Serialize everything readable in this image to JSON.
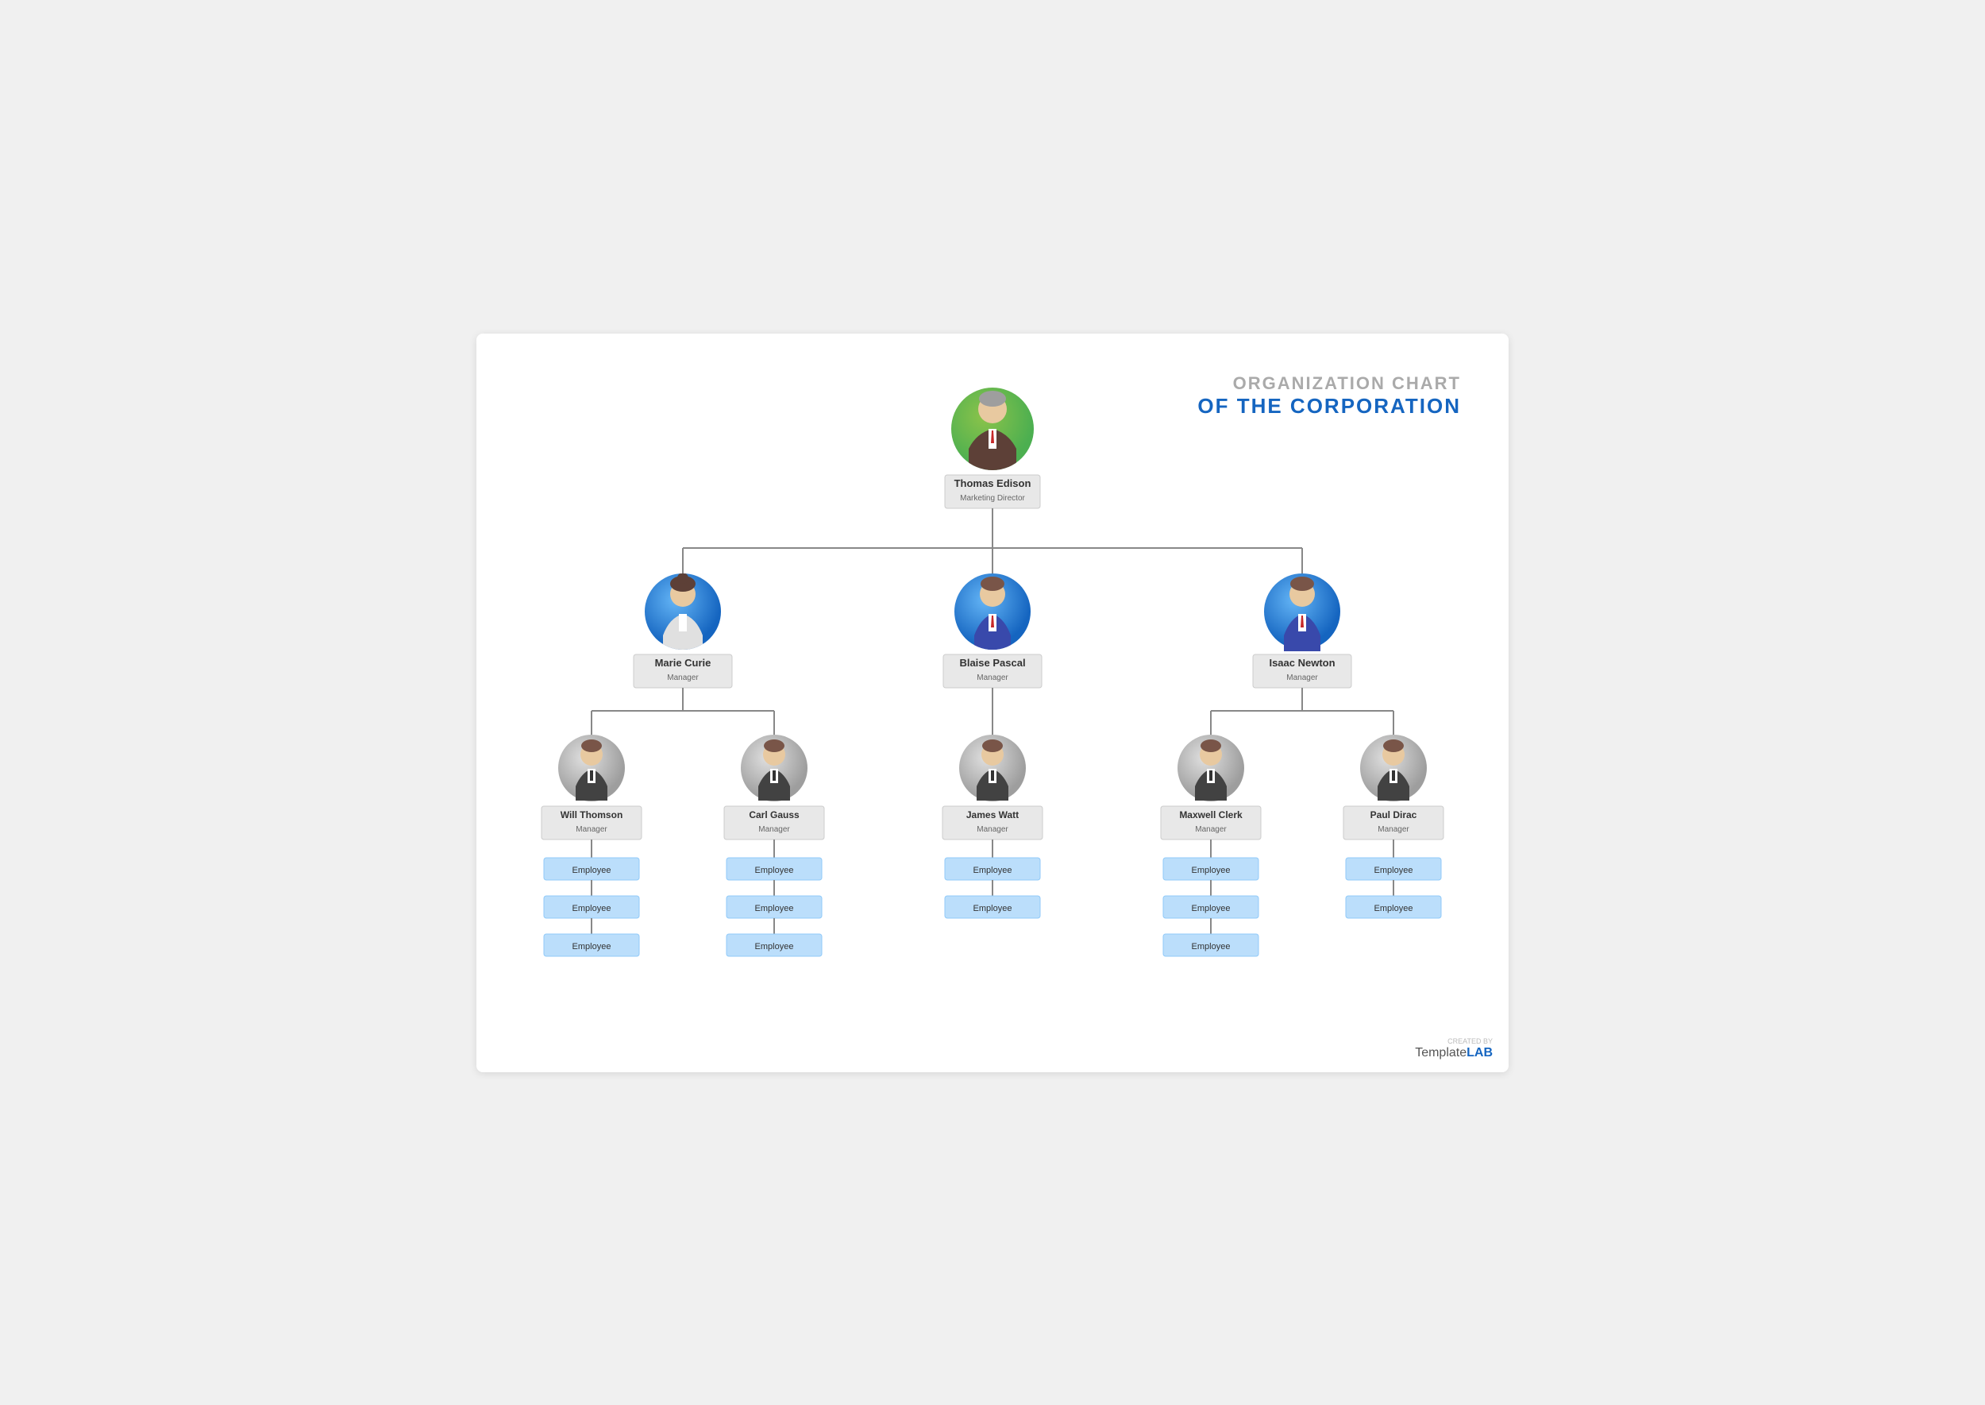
{
  "title": {
    "line1": "ORGANIZATION CHART",
    "line2": "OF THE CORPORATION"
  },
  "ceo": {
    "name": "Thomas Edison",
    "role": "Marketing Director",
    "avatar_type": "green"
  },
  "managers": [
    {
      "name": "Marie Curie",
      "role": "Manager",
      "avatar_type": "blue",
      "gender": "female"
    },
    {
      "name": "Blaise Pascal",
      "role": "Manager",
      "avatar_type": "blue",
      "gender": "male"
    },
    {
      "name": "Isaac Newton",
      "role": "Manager",
      "avatar_type": "blue",
      "gender": "male"
    }
  ],
  "team_leads": [
    {
      "name": "Will Thomson",
      "role": "Manager",
      "parent_idx": 0,
      "avatar_type": "gray"
    },
    {
      "name": "Carl Gauss",
      "role": "Manager",
      "parent_idx": 0,
      "avatar_type": "gray"
    },
    {
      "name": "James Watt",
      "role": "Manager",
      "parent_idx": 1,
      "avatar_type": "gray"
    },
    {
      "name": "Maxwell Clerk",
      "role": "Manager",
      "parent_idx": 2,
      "avatar_type": "gray"
    },
    {
      "name": "Paul Dirac",
      "role": "Manager",
      "parent_idx": 2,
      "avatar_type": "gray"
    }
  ],
  "employees": {
    "will_thomson": [
      "Employee",
      "Employee",
      "Employee"
    ],
    "carl_gauss": [
      "Employee",
      "Employee",
      "Employee"
    ],
    "james_watt": [
      "Employee",
      "Employee"
    ],
    "maxwell_clerk": [
      "Employee",
      "Employee",
      "Employee"
    ],
    "paul_dirac": [
      "Employee",
      "Employee"
    ]
  },
  "watermark": {
    "created_by": "CREATED BY",
    "brand_normal": "Template",
    "brand_bold": "LAB"
  }
}
